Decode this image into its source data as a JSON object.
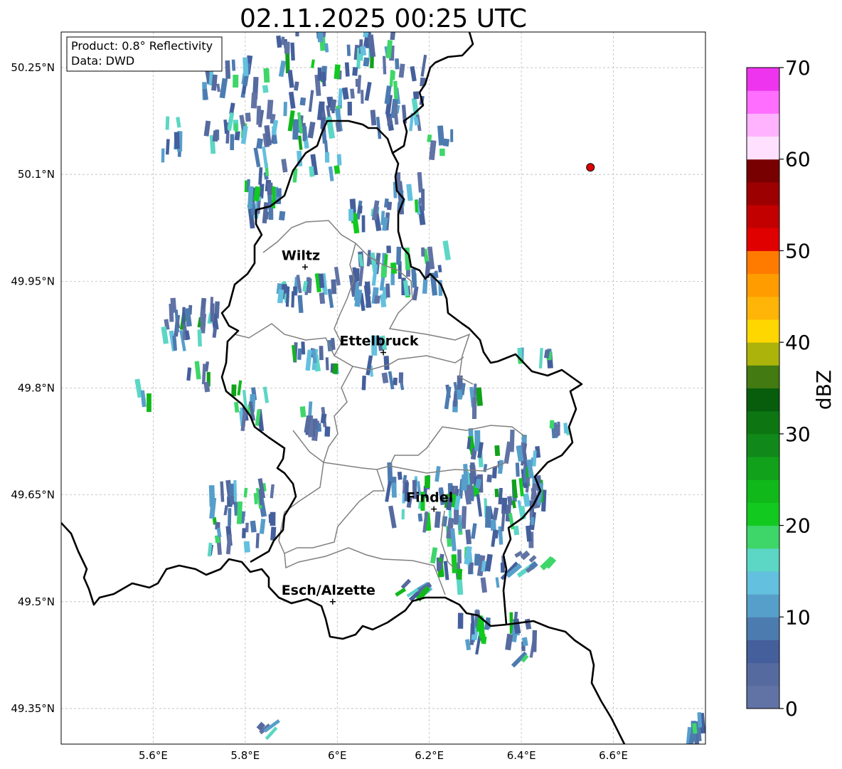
{
  "title": "02.11.2025 00:25 UTC",
  "info_box": {
    "product": "Product: 0.8° Reflectivity",
    "data_source": "Data: DWD"
  },
  "axes": {
    "lon_min": 5.4,
    "lon_max": 6.8,
    "lat_min": 49.3,
    "lat_max": 50.3,
    "lon_ticks": [
      {
        "value": 5.6,
        "label": "5.6°E"
      },
      {
        "value": 5.8,
        "label": "5.8°E"
      },
      {
        "value": 6.0,
        "label": "6°E"
      },
      {
        "value": 6.2,
        "label": "6.2°E"
      },
      {
        "value": 6.4,
        "label": "6.4°E"
      },
      {
        "value": 6.6,
        "label": "6.6°E"
      }
    ],
    "lat_ticks": [
      {
        "value": 50.25,
        "label": "50.25°N"
      },
      {
        "value": 50.1,
        "label": "50.1°N"
      },
      {
        "value": 49.95,
        "label": "49.95°N"
      },
      {
        "value": 49.8,
        "label": "49.8°N"
      },
      {
        "value": 49.65,
        "label": "49.65°N"
      },
      {
        "value": 49.5,
        "label": "49.5°N"
      },
      {
        "value": 49.35,
        "label": "49.35°N"
      }
    ],
    "grid": true
  },
  "cities": [
    {
      "name": "Wiltz",
      "lon": 5.93,
      "lat": 49.97
    },
    {
      "name": "Ettelbruck",
      "lon": 6.1,
      "lat": 49.85
    },
    {
      "name": "Findel",
      "lon": 6.21,
      "lat": 49.63
    },
    {
      "name": "Esch/Alzette",
      "lon": 5.99,
      "lat": 49.5
    }
  ],
  "radar_site": {
    "lon": 6.55,
    "lat": 50.11,
    "color": "#dd0000"
  },
  "colorbar": {
    "label": "dBZ",
    "min": 0,
    "max": 70,
    "step": 2.5,
    "tick_labels": [
      "0",
      "10",
      "20",
      "30",
      "40",
      "50",
      "60",
      "70"
    ],
    "colors": [
      "#6173a5",
      "#556a9f",
      "#445f9c",
      "#4c7bb0",
      "#579fcb",
      "#63c0de",
      "#5cd6c5",
      "#3ed669",
      "#12c91f",
      "#10b81a",
      "#11a11a",
      "#10891a",
      "#0d7613",
      "#085d0d",
      "#437a12",
      "#acb30a",
      "#fed600",
      "#ffb507",
      "#ff9d00",
      "#ff7b00",
      "#e00000",
      "#c30000",
      "#9c0000",
      "#780000",
      "#ffe1ff",
      "#ffb3ff",
      "#ff6eff",
      "#ee34ee"
    ]
  }
}
